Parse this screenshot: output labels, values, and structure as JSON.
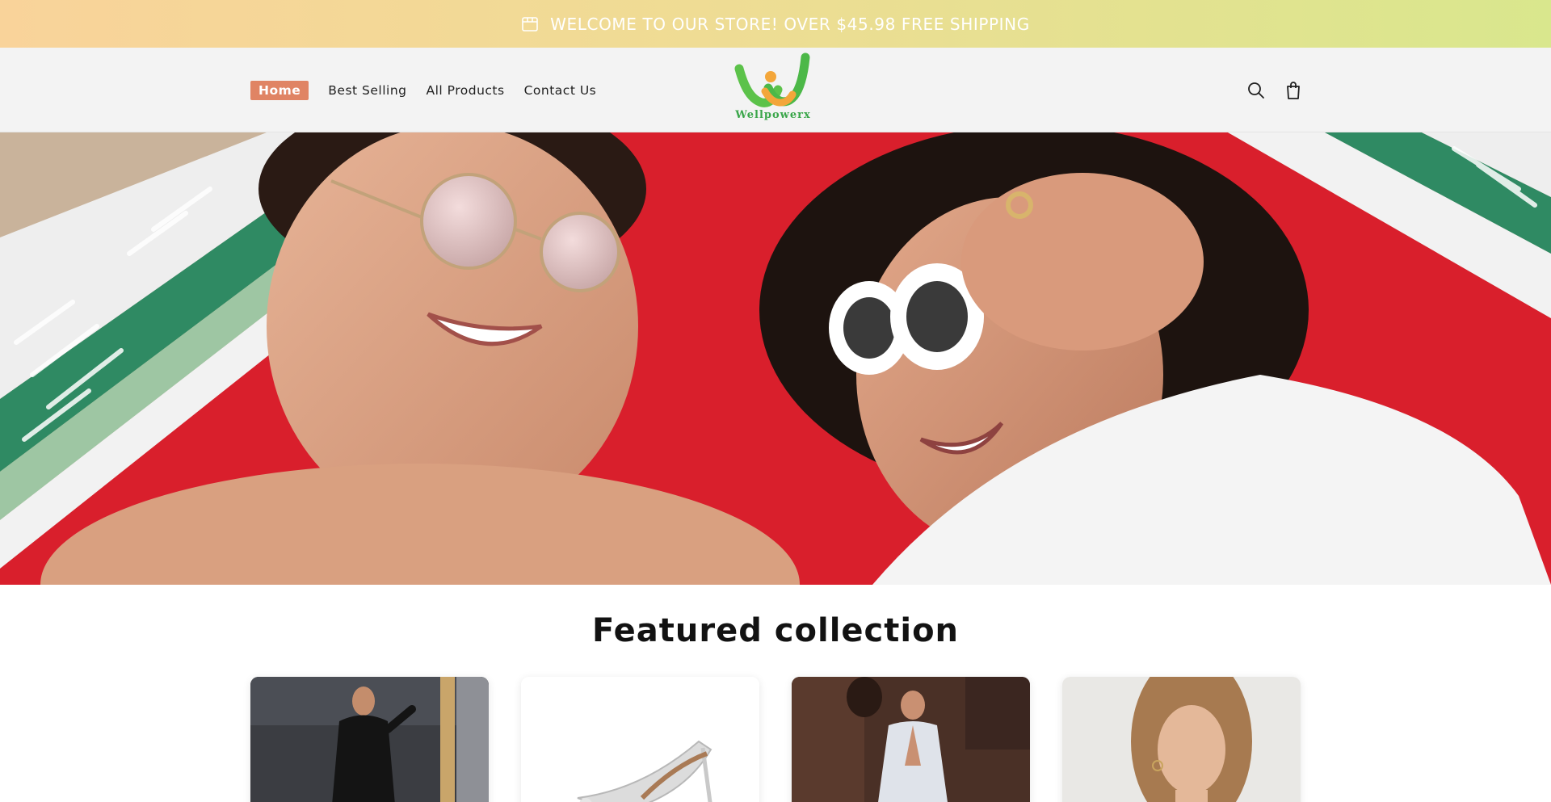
{
  "announcement": {
    "text": "WELCOME TO OUR STORE! OVER $45.98 FREE SHIPPING",
    "icon": "store-icon"
  },
  "header": {
    "nav": [
      {
        "label": "Home",
        "active": true
      },
      {
        "label": "Best Selling",
        "active": false
      },
      {
        "label": "All Products",
        "active": false
      },
      {
        "label": "Contact Us",
        "active": false
      }
    ],
    "logo_text": "Wellpowerx",
    "icons": [
      "search-icon",
      "cart-icon"
    ]
  },
  "featured": {
    "title": "Featured collection",
    "products": [
      {
        "image": "woman-black-outfit"
      },
      {
        "image": "clear-high-heel"
      },
      {
        "image": "woman-white-dress"
      },
      {
        "image": "woman-portrait"
      }
    ]
  },
  "colors": {
    "accent": "#e08464",
    "logo_green": "#3aa64a",
    "logo_orange": "#f3a63a",
    "announce_start": "#f9d39a",
    "announce_end": "#d9e78d",
    "header_bg": "#f3f3f3"
  }
}
